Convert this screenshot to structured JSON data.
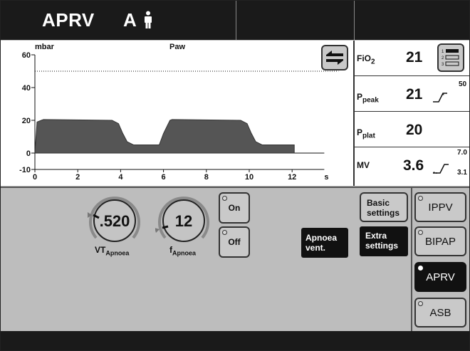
{
  "header": {
    "mode": "APRV",
    "mode_suffix": "A"
  },
  "graph": {
    "unit": "mbar",
    "signal": "Paw",
    "y_ticks": [
      "60",
      "40",
      "20",
      "0",
      "-10"
    ],
    "x_ticks": [
      "0",
      "2",
      "4",
      "6",
      "8",
      "10",
      "12"
    ],
    "x_unit": "s"
  },
  "chart_data": {
    "type": "area",
    "ylabel": "mbar",
    "title": "Paw",
    "xlabel": "s",
    "ylim": [
      -10,
      60
    ],
    "xlim": [
      0,
      13.5
    ],
    "threshold": 50,
    "x": [
      0,
      0.1,
      0.3,
      0.4,
      3.6,
      3.9,
      4.1,
      4.3,
      4.6,
      5.8,
      6.0,
      6.3,
      6.4,
      9.6,
      9.9,
      10.1,
      10.3,
      10.6,
      12.1
    ],
    "values": [
      0,
      19,
      20,
      20.5,
      20,
      18,
      12,
      7,
      5,
      5,
      12,
      20,
      20.5,
      20,
      18,
      12,
      7,
      5,
      5
    ]
  },
  "values": {
    "fio2": {
      "label": "FiO",
      "sub": "2",
      "value": "21"
    },
    "ppeak": {
      "label": "P",
      "sub": "peak",
      "value": "21",
      "alarm_high": "50"
    },
    "pplat": {
      "label": "P",
      "sub": "plat",
      "value": "20"
    },
    "mv": {
      "label": "MV",
      "value": "3.6",
      "alarm_high": "7.0",
      "alarm_low": "3.1"
    }
  },
  "controls": {
    "vt": {
      "value": ".520",
      "label": "VT",
      "sub": "Apnoea"
    },
    "f": {
      "value": "12",
      "label": "f",
      "sub": "Apnoea"
    },
    "on_label": "On",
    "off_label": "Off",
    "apnoea_vent": [
      "Apnoea",
      "vent."
    ],
    "basic_settings": [
      "Basic",
      "settings"
    ],
    "extra_settings": [
      "Extra",
      "settings"
    ]
  },
  "modes": [
    {
      "label": "IPPV",
      "active": false
    },
    {
      "label": "BIPAP",
      "active": false
    },
    {
      "label": "APRV",
      "active": true
    },
    {
      "label": "ASB",
      "active": false
    }
  ],
  "colors": {
    "background": "#bdbdbd",
    "dark": "#1a1a1a",
    "active": "#111111"
  },
  "icons": [
    "person-icon",
    "swap-waveform-icon",
    "level-select-icon",
    "alarm-limit-icon"
  ]
}
